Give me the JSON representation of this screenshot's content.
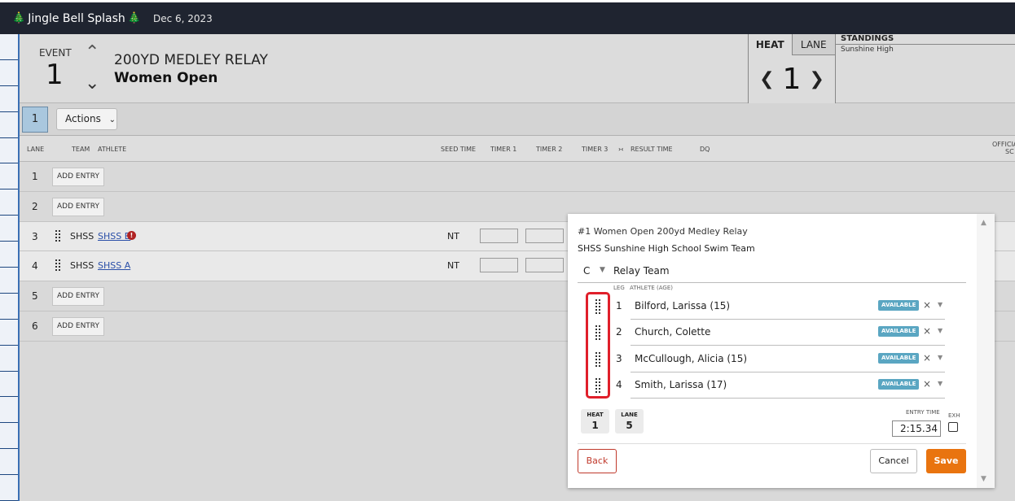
{
  "topbar": {
    "tree_left": "🎄",
    "meet_name": "Jingle Bell Splash",
    "tree_right": "🎄",
    "date": "Dec 6, 2023"
  },
  "event": {
    "label": "EVENT",
    "number": "1",
    "up_icon": "⌃",
    "down_icon": "⌄",
    "title": "200YD MEDLEY RELAY",
    "subtitle": "Women Open"
  },
  "heat_nav": {
    "heat_tab": "HEAT",
    "lane_tab": "LANE",
    "prev": "❮",
    "number": "1",
    "next": "❯"
  },
  "standings": {
    "title": "STANDINGS",
    "value": "Sunshine High"
  },
  "heat_tabs": {
    "active": "1",
    "actions_label": "Actions",
    "actions_caret": "⌄"
  },
  "columns": {
    "lane": "LANE",
    "team": "TEAM",
    "athlete": "ATHLETE",
    "seed_time": "SEED TIME",
    "timer1": "TIMER 1",
    "timer2": "TIMER 2",
    "timer3": "TIMER 3",
    "swap_icon": "›‹",
    "result_time": "RESULT TIME",
    "dq": "DQ",
    "official": "OFFICIA",
    "sc": "SC"
  },
  "rows": [
    {
      "lane": "1",
      "add_label": "ADD ENTRY"
    },
    {
      "lane": "2",
      "add_label": "ADD ENTRY"
    },
    {
      "lane": "3",
      "team": "SHSS",
      "athlete": "SHSS B",
      "warn": "!",
      "seed": "NT"
    },
    {
      "lane": "4",
      "team": "SHSS",
      "athlete": "SHSS A",
      "seed": "NT"
    },
    {
      "lane": "5",
      "add_label": "ADD ENTRY"
    },
    {
      "lane": "6",
      "add_label": "ADD ENTRY"
    }
  ],
  "modal": {
    "event_line": "#1 Women Open 200yd Medley Relay",
    "team_line": "SHSS Sunshine High School Swim Team",
    "relay_code": "C",
    "relay_caret": "▼",
    "relay_label": "Relay Team",
    "leg_header": "LEG",
    "athlete_header": "ATHLETE (AGE)",
    "legs": [
      {
        "n": "1",
        "name": "Bilford, Larissa (15)",
        "status": "AVAILABLE"
      },
      {
        "n": "2",
        "name": "Church, Colette",
        "status": "AVAILABLE"
      },
      {
        "n": "3",
        "name": "McCullough, Alicia (15)",
        "status": "AVAILABLE"
      },
      {
        "n": "4",
        "name": "Smith, Larissa (17)",
        "status": "AVAILABLE"
      }
    ],
    "remove_icon": "×",
    "dropdown_icon": "▼",
    "heat_label": "HEAT",
    "heat_value": "1",
    "lane_label": "LANE",
    "lane_value": "5",
    "entry_time_label": "ENTRY TIME",
    "entry_time_value": "2:15.34",
    "exh_label": "EXH",
    "back_label": "Back",
    "cancel_label": "Cancel",
    "save_label": "Save",
    "scroll_up": "▲",
    "scroll_down": "▼"
  }
}
